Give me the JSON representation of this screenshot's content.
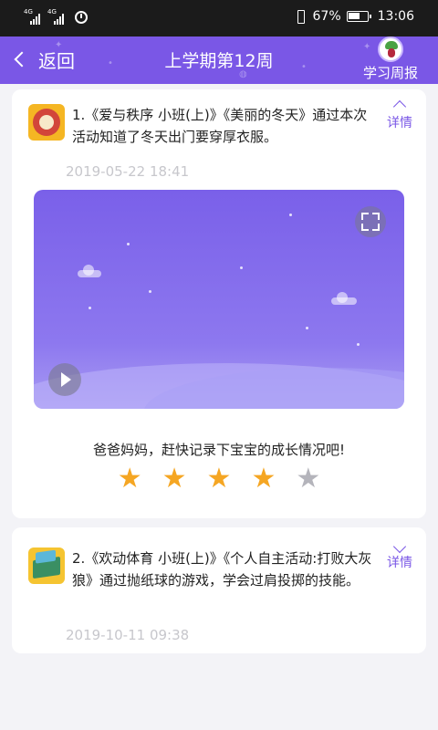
{
  "status_bar": {
    "signal_1_label": "4G",
    "signal_2_label": "4G",
    "battery_percent": "67%",
    "time": "13:06"
  },
  "header": {
    "back_label": "返回",
    "title": "上学期第12周",
    "report_label": "学习周报"
  },
  "activities": [
    {
      "description": "1.《爱与秩序 小班(上)》《美丽的冬天》通过本次活动知道了冬天出门要穿厚衣服。",
      "detail_label": "详情",
      "date": "2019-05-22 18:41",
      "prompt": "爸爸妈妈，赶快记录下宝宝的成长情况吧!",
      "rating": 4,
      "rating_max": 5
    },
    {
      "description": "2.《欢动体育 小班(上)》《个人自主活动:打败大灰狼》通过抛纸球的游戏，学会过肩投掷的技能。",
      "detail_label": "详情",
      "date": "2019-10-11 09:38"
    }
  ],
  "colors": {
    "accent": "#7a57e6",
    "star_on": "#f5a623",
    "star_off": "#b4b4bb"
  }
}
